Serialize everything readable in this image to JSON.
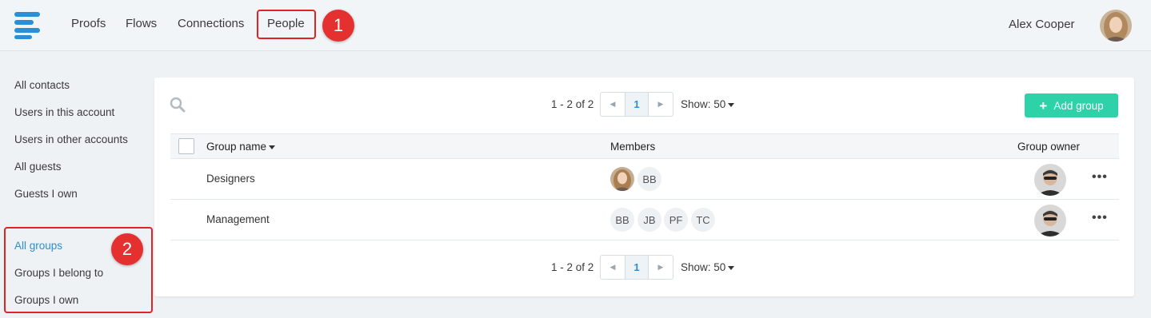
{
  "nav": {
    "items": [
      "Proofs",
      "Flows",
      "Connections",
      "People"
    ]
  },
  "callouts": [
    "1",
    "2"
  ],
  "user": {
    "name": "Alex Cooper"
  },
  "sidebar": {
    "contacts": [
      "All contacts",
      "Users in this account",
      "Users in other accounts",
      "All guests",
      "Guests I own"
    ],
    "groups": [
      "All groups",
      "Groups I belong to",
      "Groups I own"
    ],
    "active": "All groups"
  },
  "pagination": {
    "range": "1 - 2 of 2",
    "page": "1",
    "show_label": "Show: 50"
  },
  "toolbar": {
    "add_group_label": "Add group"
  },
  "table": {
    "columns": [
      "Group name",
      "Members",
      "Group owner"
    ],
    "rows": [
      {
        "name": "Designers",
        "members": [
          "BB"
        ]
      },
      {
        "name": "Management",
        "members": [
          "BB",
          "JB",
          "PF",
          "TC"
        ]
      }
    ]
  },
  "colors": {
    "accent": "#2a8fd6",
    "primary_button": "#2fd1a8",
    "annotation": "#e53030"
  },
  "icons": [
    "menu-logo-icon",
    "search-icon",
    "chevron-left-icon",
    "chevron-right-icon",
    "caret-down-icon",
    "plus-icon",
    "more-icon"
  ]
}
